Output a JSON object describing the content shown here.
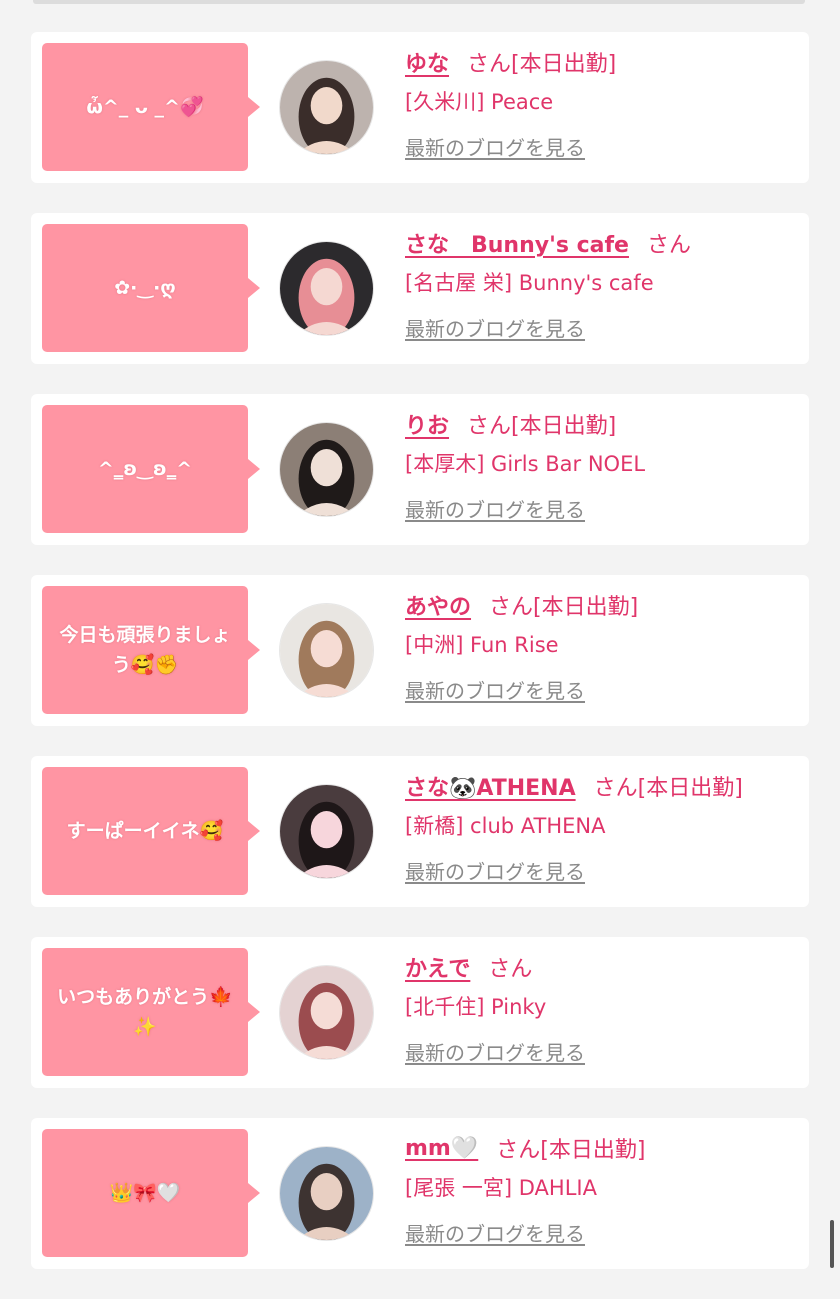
{
  "entries": [
    {
      "bubble": "ὦ^_ ᴗ _^💞",
      "name": "ゆな",
      "suffix": "さん[本日出勤]",
      "shop": "[久米川] Peace",
      "blog": "最新のブログを見る",
      "avatar_colors": [
        "#bdb3ae",
        "#3a2d2a",
        "#f1d9cb"
      ]
    },
    {
      "bubble": "✿·‿·ღ",
      "name": "さな　Bunny's cafe",
      "suffix": "さん",
      "shop": "[名古屋 栄] Bunny's cafe",
      "blog": "最新のブログを見る",
      "avatar_colors": [
        "#2c2a2d",
        "#e78e95",
        "#f5d8d2"
      ]
    },
    {
      "bubble": "^‗ʚ‿ʚ‗^",
      "name": "りお",
      "suffix": "さん[本日出勤]",
      "shop": "[本厚木] Girls Bar NOEL",
      "blog": "最新のブログを見る",
      "avatar_colors": [
        "#8c7f76",
        "#1f1a19",
        "#efe0d7"
      ]
    },
    {
      "bubble": "今日も頑張りましょう🥰✊",
      "name": "あやの",
      "suffix": "さん[本日出勤]",
      "shop": "[中洲] Fun Rise",
      "blog": "最新のブログを見る",
      "avatar_colors": [
        "#e9e6e2",
        "#a07a5c",
        "#f6dcd4"
      ]
    },
    {
      "bubble": "すーぱーイイネ🥰",
      "name": "さな🐼ATHENA",
      "suffix": "さん[本日出勤]",
      "shop": "[新橋] club ATHENA",
      "blog": "最新のブログを見る",
      "avatar_colors": [
        "#4a3c3e",
        "#1e1718",
        "#f7d6dc"
      ]
    },
    {
      "bubble": "いつもありがとう🍁✨",
      "name": "かえで",
      "suffix": "さん",
      "shop": "[北千住] Pinky",
      "blog": "最新のブログを見る",
      "avatar_colors": [
        "#e4d2d2",
        "#9b4c4f",
        "#f5dcd6"
      ]
    },
    {
      "bubble": "👑🎀🤍",
      "name": "mm🤍",
      "suffix": "さん[本日出勤]",
      "shop": "[尾張 一宮] DAHLIA",
      "blog": "最新のブログを見る",
      "avatar_colors": [
        "#9db2c8",
        "#3d3331",
        "#e8cfc2"
      ]
    }
  ]
}
